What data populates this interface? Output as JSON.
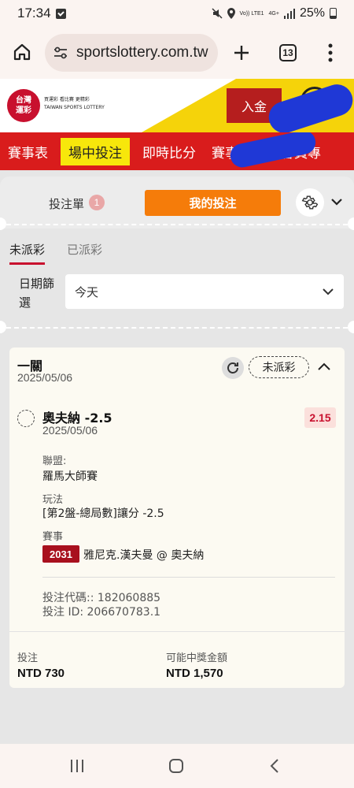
{
  "status_bar": {
    "time": "17:34",
    "network_label": "Vo)) LTE1",
    "network_type": "4G+",
    "battery": "25%"
  },
  "browser": {
    "url": "sportslottery.com.tw",
    "tab_count": "13"
  },
  "site_header": {
    "logo_line1": "台灣",
    "logo_line2": "運彩",
    "logo_tagline": "買運彩 看比賽 更精彩",
    "logo_subtitle": "TAIWAN SPORTS LOTTERY",
    "deposit_label": "入金"
  },
  "nav": {
    "tabs": [
      {
        "label": "賽事表"
      },
      {
        "label": "場中投注"
      },
      {
        "label": "即時比分"
      },
      {
        "label": "賽事數據"
      },
      {
        "label": "會員專"
      }
    ]
  },
  "betslip": {
    "label": "投注單",
    "count": "1",
    "my_bets_label": "我的投注",
    "subtabs": [
      "未派彩",
      "已派彩"
    ],
    "date_filter_label": "日期篩選",
    "date_filter_value": "今天"
  },
  "bet": {
    "type": "一關",
    "date": "2025/05/06",
    "status": "未派彩",
    "selection": "奧夫納 -2.5",
    "selection_date": "2025/05/06",
    "odds": "2.15",
    "league_label": "聯盟:",
    "league": "羅馬大師賽",
    "market_label": "玩法",
    "market": "[第2盤-總局數]讓分 -2.5",
    "event_label": "賽事",
    "event_code": "2031",
    "event_name": "雅尼克.漢夫曼 @ 奧夫納",
    "bet_code": "投注代碼:: 182060885",
    "bet_id": "投注 ID: 206670783.1",
    "stake_label": "投注",
    "stake": "NTD 730",
    "payout_label": "可能中獎金額",
    "payout": "NTD 1,570"
  },
  "colors": {
    "brand_red": "#d91c1c",
    "brand_yellow": "#f5d30a",
    "accent_orange": "#f57c0a"
  }
}
